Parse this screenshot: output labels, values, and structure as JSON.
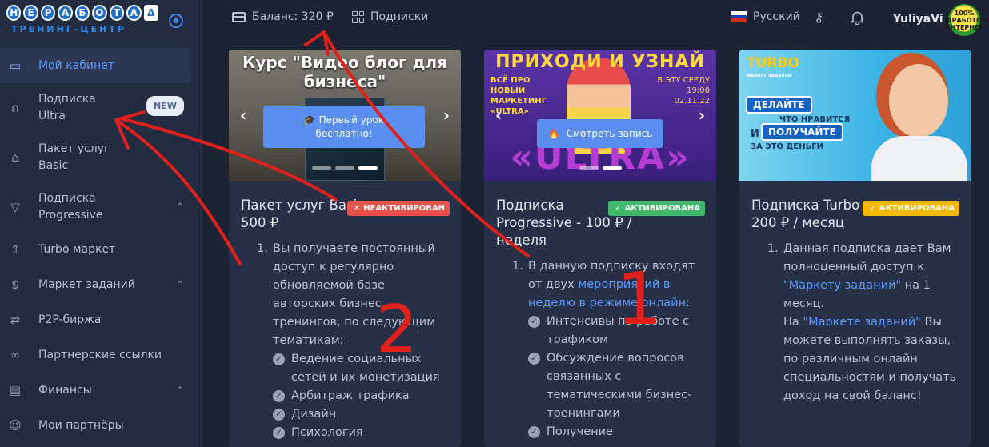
{
  "brand": {
    "logo_letters": [
      "Н",
      "Е",
      "Р",
      "А",
      "Б",
      "О",
      "Т",
      "А",
      "Δ"
    ],
    "subtitle": "ТРЕНИНГ-ЦЕНТР"
  },
  "sidebar": {
    "items": [
      {
        "label": "Мой кабинет",
        "icon": "monitor-icon",
        "active": true
      },
      {
        "label": "Подписка Ultra",
        "icon": "headphones-icon",
        "badge": "NEW"
      },
      {
        "label": "Пакет услуг Basic",
        "icon": "bank-icon"
      },
      {
        "label": "Подписка Progressive",
        "icon": "diamond-icon",
        "expandable": true
      },
      {
        "label": "Turbo маркет",
        "icon": "rocket-icon"
      },
      {
        "label": "Маркет заданий",
        "icon": "dollar-icon",
        "expandable": true
      },
      {
        "label": "P2P-биржа",
        "icon": "swap-icon"
      },
      {
        "label": "Партнерские ссылки",
        "icon": "link-icon"
      },
      {
        "label": "Финансы",
        "icon": "wallet-icon",
        "expandable": true
      },
      {
        "label": "Мои партнёры",
        "icon": "users-icon"
      }
    ]
  },
  "header": {
    "balance": "Баланс: 320 ₽",
    "subscriptions": "Подписки",
    "language": "Русский",
    "username": "YuliyaVi",
    "avatar_text": "100% НАРАБОТОК ИНТЕРНЕТ"
  },
  "cards": [
    {
      "banner": {
        "title": "Курс \"Видео блог для бизнеса\"",
        "button": "Первый урок бесплатно!"
      },
      "title": "Пакет услуг Basic - 500 ₽",
      "status": "НЕАКТИВИРОВАН",
      "item1": "Вы получаете постоянный доступ к регулярно обновляемой базе авторских бизнес тренингов, по следующим тематикам:",
      "checks": [
        "Ведение социальных сетей и их монетизация",
        "Арбитраж трафика",
        "Дизайн",
        "Психология"
      ]
    },
    {
      "banner": {
        "title": "ПРИХОДИ И УЗНАЙ",
        "sub": "ВСЁ ПРО НОВЫЙ МАРКЕТИНГ «ULTRA»",
        "date": "В ЭТУ СРЕДУ 19:00 02.11.22",
        "big": "«ULTRA»",
        "button": "Смотреть запись"
      },
      "title": "Подписка Progressive - 100 ₽ / неделя",
      "status": "АКТИВИРОВАНА",
      "item1_pre": "В данную подписку входят от двух ",
      "item1_link": "мероприятий в неделю в режиме онлайн",
      "item1_post": ":",
      "checks": [
        "Интенсивы по работе с трафиком",
        "Обсуждение вопросов связанных с тематическими бизнес-тренингами",
        "Получение"
      ]
    },
    {
      "banner": {
        "logo": "TURBO",
        "logo_sub": "маркет задания",
        "pill1": "ДЕЛАЙТЕ",
        "note1": "ЧТО НРАВИТСЯ",
        "and": "И",
        "pill2": "ПОЛУЧАЙТЕ",
        "note2": "ЗА ЭТО ДЕНЬГИ"
      },
      "title": "Подписка Turbo - 200 ₽ / месяц",
      "status": "АКТИВИРОВАНА",
      "p1_pre": "Данная подписка дает Вам полноценный доступ к ",
      "p1_link": "\"Маркету заданий\"",
      "p1_post": " на 1 месяц.",
      "p2_pre": "На ",
      "p2_link": "\"Маркете заданий\"",
      "p2_post": " Вы можете выполнять заказы, по различным онлайн специальностям и получать доход на свой баланс!"
    }
  ],
  "colors": {
    "accent": "#5b9bff",
    "red": "#e5534b",
    "green": "#3fb96b",
    "yellow": "#f5b800",
    "annotation": "#e0201b"
  },
  "annotations": [
    "1",
    "2"
  ]
}
